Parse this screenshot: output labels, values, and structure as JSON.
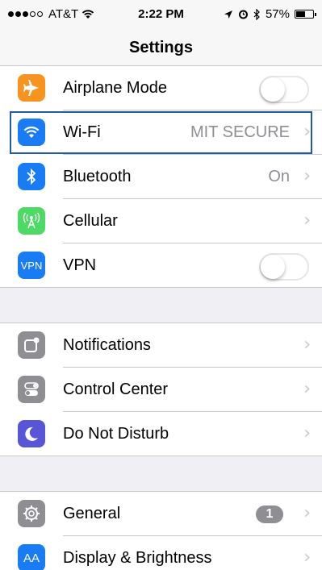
{
  "status_bar": {
    "carrier": "AT&T",
    "time": "2:22 PM",
    "battery_pct": "57%",
    "battery_level": 0.57
  },
  "nav": {
    "title": "Settings"
  },
  "groups": [
    {
      "items": [
        {
          "label": "Airplane Mode",
          "icon": "airplane-icon",
          "icon_color": "#f7931e",
          "control": "toggle",
          "on": false
        },
        {
          "label": "Wi-Fi",
          "icon": "wifi-icon",
          "icon_color": "#1a7cf5",
          "value": "MIT SECURE",
          "control": "chevron",
          "focused": true
        },
        {
          "label": "Bluetooth",
          "icon": "bluetooth-icon",
          "icon_color": "#1a7cf5",
          "value": "On",
          "control": "chevron"
        },
        {
          "label": "Cellular",
          "icon": "cellular-icon",
          "icon_color": "#4cd964",
          "control": "chevron"
        },
        {
          "label": "VPN",
          "icon": "vpn-icon",
          "icon_text": "VPN",
          "icon_color": "#1a7cf5",
          "control": "toggle",
          "on": false
        }
      ]
    },
    {
      "items": [
        {
          "label": "Notifications",
          "icon": "notifications-icon",
          "icon_color": "#8e8e93",
          "control": "chevron"
        },
        {
          "label": "Control Center",
          "icon": "control-center-icon",
          "icon_color": "#8e8e93",
          "control": "chevron"
        },
        {
          "label": "Do Not Disturb",
          "icon": "moon-icon",
          "icon_color": "#5856d6",
          "control": "chevron"
        }
      ]
    },
    {
      "items": [
        {
          "label": "General",
          "icon": "gear-icon",
          "icon_color": "#8e8e93",
          "badge": "1",
          "control": "chevron"
        },
        {
          "label": "Display & Brightness",
          "icon": "display-icon",
          "icon_text": "AA",
          "icon_color": "#1a7cf5",
          "control": "chevron"
        }
      ]
    }
  ]
}
